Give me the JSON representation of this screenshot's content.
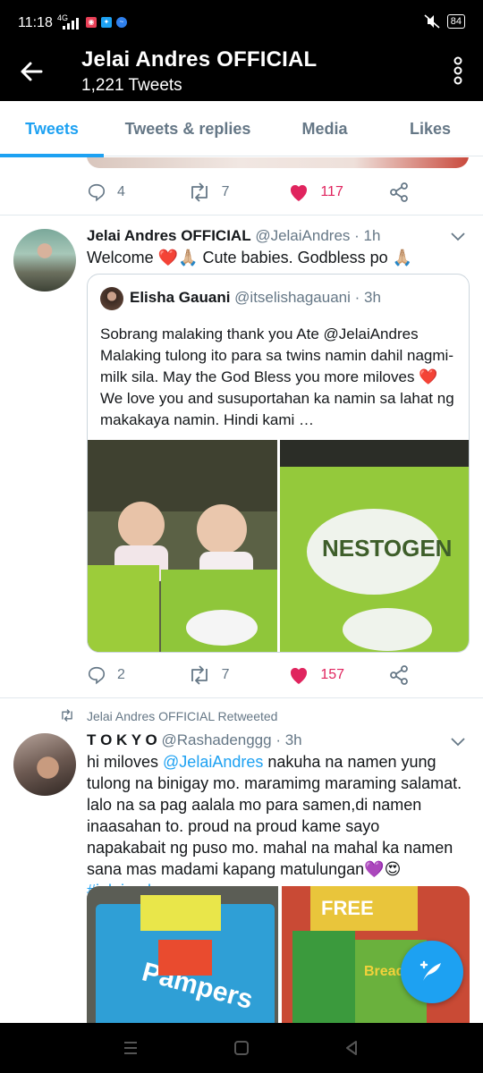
{
  "status_bar": {
    "time": "11:18",
    "network": "4G",
    "battery": "84",
    "icons": [
      "signal-icon",
      "notification-app-icon",
      "twitter-icon",
      "messenger-icon",
      "mute-icon",
      "battery-icon"
    ]
  },
  "header": {
    "title": "Jelai Andres OFFICIAL",
    "tweet_count": "1,221 Tweets"
  },
  "tabs": [
    {
      "label": "Tweets",
      "active": true
    },
    {
      "label": "Tweets & replies",
      "active": false
    },
    {
      "label": "Media",
      "active": false
    },
    {
      "label": "Likes",
      "active": false
    }
  ],
  "tweets": [
    {
      "replies": "4",
      "retweets": "7",
      "likes": "117",
      "liked": true
    },
    {
      "name": "Jelai Andres OFFICIAL",
      "handle": "@JelaiAndres",
      "time": "· 1h",
      "text": "Welcome ❤️🙏🏼 Cute babies. Godbless po 🙏🏼",
      "quote": {
        "name": "Elisha Gauani",
        "handle": "@itselishagauani",
        "time": "· 3h",
        "text": "Sobrang malaking thank you Ate @JelaiAndres Malaking tulong ito para sa twins namin dahil nagmi-milk sila. May the God Bless you more miloves ❤️ We love you and susuportahan ka namin sa lahat ng makakaya namin. Hindi kami …"
      },
      "replies": "2",
      "retweets": "7",
      "likes": "157",
      "liked": true
    },
    {
      "retweeted_by": "Jelai Andres OFFICIAL Retweeted",
      "name": "T O K Y O",
      "handle": "@Rashadenggg",
      "time": "· 3h",
      "text_before": "hi miloves ",
      "mention": "@JelaiAndres",
      "text_after": " nakuha na namen yung tulong na binigay mo. maramimg maraming salamat. lalo na sa pag aalala mo para samen,di namen inaasahan to. proud na proud kame sayo napakabait ng puso mo. mahal na mahal ka namen sana mas madami kapang matulungan💜😍 ",
      "hashtag": "#jelaiandres"
    }
  ],
  "colors": {
    "accent": "#1da1f2",
    "like": "#e0245e",
    "muted": "#657786"
  }
}
